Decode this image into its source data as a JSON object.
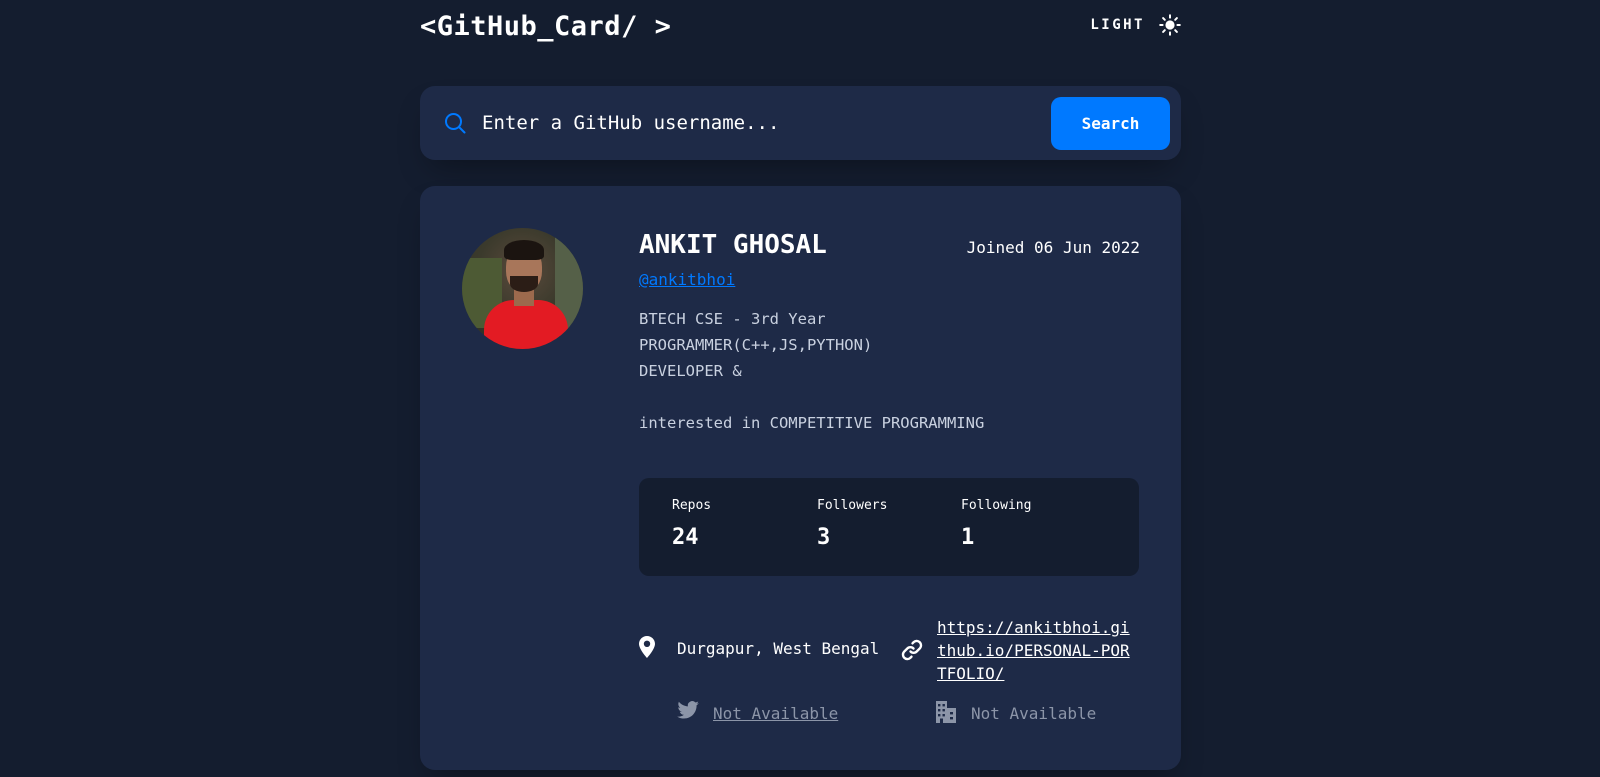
{
  "header": {
    "logo": "<GitHub_Card/ >",
    "theme_label": "LIGHT",
    "theme_icon": "sun-icon"
  },
  "search": {
    "icon": "search-icon",
    "placeholder": "Enter a GitHub username...",
    "value": "",
    "button_label": "Search"
  },
  "profile": {
    "name": "ANKIT GHOSAL",
    "joined": "Joined 06 Jun 2022",
    "login": "@ankitbhoi",
    "bio": "BTECH CSE - 3rd Year\nPROGRAMMER(C++,JS,PYTHON)\nDEVELOPER &\n\ninterested in COMPETITIVE PROGRAMMING",
    "stats": {
      "repos_label": "Repos",
      "repos": "24",
      "followers_label": "Followers",
      "followers": "3",
      "following_label": "Following",
      "following": "1"
    },
    "location": "Durgapur, West Bengal",
    "blog": "https://ankitbhoi.github.io/PERSONAL-PORTFOLIO/",
    "twitter": "Not Available",
    "company": "Not Available"
  },
  "colors": {
    "background": "#141d2f",
    "card": "#1e2a47",
    "accent": "#0079ff",
    "muted": "#8c95a8"
  }
}
